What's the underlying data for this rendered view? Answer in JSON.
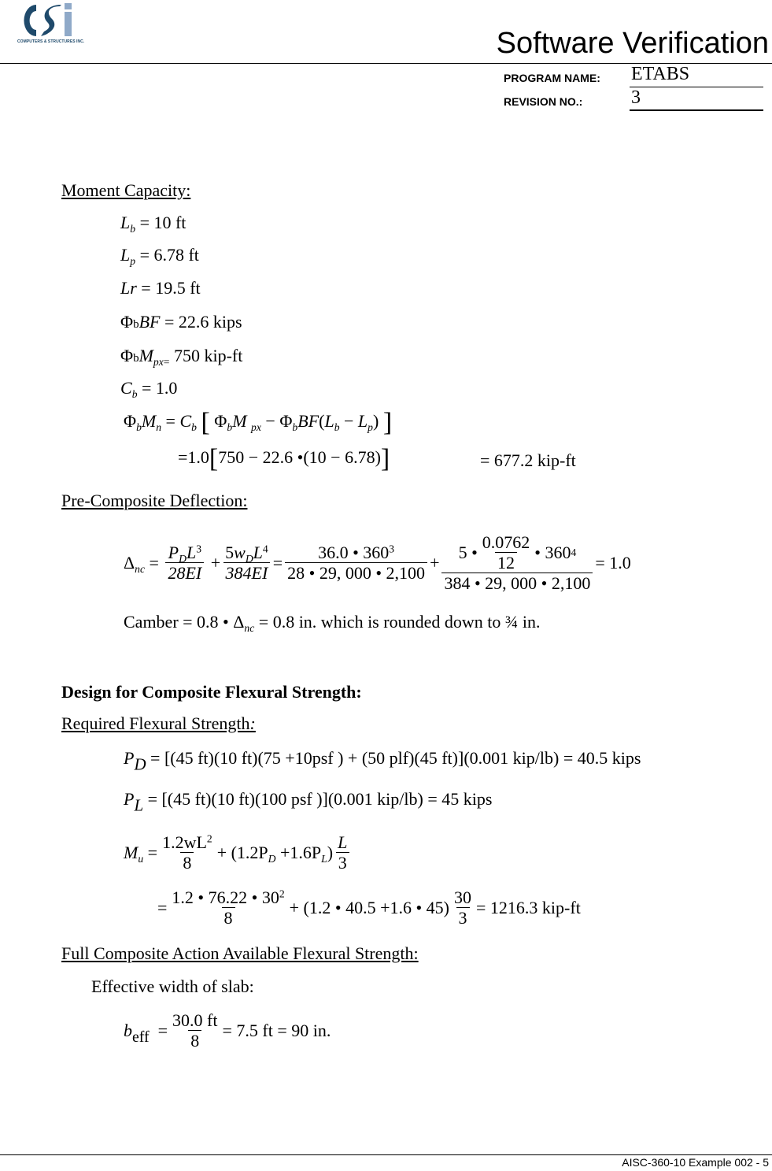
{
  "header": {
    "logo_text": "CSi",
    "logo_subtitle": "COMPUTERS & STRUCTURES INC.",
    "title": "Software Verification",
    "program_name_label": "PROGRAM NAME:",
    "program_name_value": "ETABS",
    "revision_label": "REVISION NO.:",
    "revision_value": "3"
  },
  "colors": {
    "logo_dark": "#1f4a6b",
    "logo_light": "#8fa9c8"
  },
  "moment_capacity": {
    "heading": "Moment Capacity:",
    "Lb": "= 10 ft",
    "Lp": "= 6.78 ft",
    "Lr": "= 19.5 ft",
    "phiBF": "= 22.6 kips",
    "phiMpx": "750 kip-ft",
    "Cb": "= 1.0",
    "eq2_prefix": "=1.0",
    "eq2_body": "750 − 22.6  •(10 − 6.78)",
    "result": "= 677.2 kip-ft"
  },
  "pre_composite": {
    "heading": "Pre-Composite Deflection:",
    "t1_den": "28EI",
    "t2_den": "384EI",
    "n1_num": "36.0 • 360",
    "n1_exp": "3",
    "n1_den": "28 • 29, 000 • 2,100",
    "n2_inner_num": "0.0762",
    "n2_inner_den": "12",
    "n2_tail": "• 360",
    "n2_exp": "4",
    "n2_den": "384 • 29, 000 • 2,100",
    "result": "= 1.0",
    "camber_lhs": "Camber = 0.8 • Δ",
    "camber_sub": "nc",
    "camber_rhs": "= 0.8 in.  which is rounded down to ¾ in."
  },
  "design": {
    "heading": "Design for Composite Flexural Strength:",
    "required_heading": "Required Flexural Strength",
    "required_colon": ":",
    "PD_rhs": "= [(45 ft)(10 ft)(75 +10psf ) + (50 plf)(45 ft)](0.001 kip/lb) = 40.5 kips",
    "PL_rhs": "= [(45 ft)(10 ft)(100 psf )](0.001 kip/lb) = 45 kips",
    "Mu_num": "1.2wL",
    "Mu_mid": "+ (1.2P",
    "Mu_mid2": " +1.6P",
    "Mu_num2_num": "1.2 • 76.22  • 30",
    "Mu_line2_mid": "+ (1.2 • 40.5 +1.6 • 45)",
    "Mu_result": "= 1216.3 kip-ft",
    "full_heading": "Full Composite Action Available Flexural Strength:",
    "eff_width_label": "Effective width of slab:",
    "beff_num": "30.0 ft",
    "beff_den": "8",
    "beff_result": "= 7.5 ft = 90 in."
  },
  "footer": {
    "text": "AISC-360-10 Example 002 - 5"
  }
}
